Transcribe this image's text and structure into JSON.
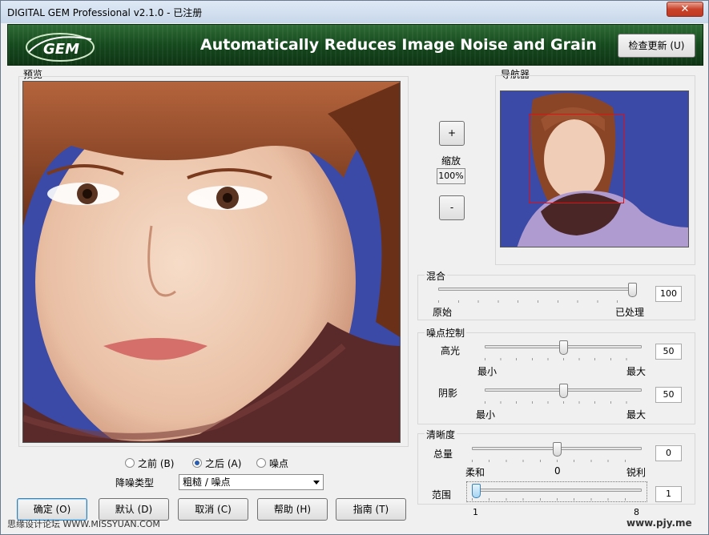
{
  "window": {
    "title": "DIGITAL GEM Professional  v2.1.0 - 已注册",
    "close_label": "✕"
  },
  "banner": {
    "logo_text": "GEM",
    "tagline": "Automatically Reduces Image Noise and Grain",
    "update_label": "检查更新 (U)"
  },
  "preview": {
    "label": "预览"
  },
  "navigator": {
    "label": "导航器"
  },
  "zoom": {
    "plus": "+",
    "label": "缩放",
    "value": "100%",
    "minus": "-"
  },
  "blend": {
    "label": "混合",
    "value": "100",
    "min_label": "原始",
    "max_label": "已处理",
    "level": 1.0
  },
  "noise": {
    "label": "噪点控制",
    "highlight": {
      "label": "高光",
      "value": "50",
      "min": "最小",
      "max": "最大",
      "level": 0.5
    },
    "shadow": {
      "label": "阴影",
      "value": "50",
      "min": "最小",
      "max": "最大",
      "level": 0.5
    }
  },
  "sharpness": {
    "label": "清晰度",
    "amount": {
      "label": "总量",
      "value": "0",
      "min": "柔和",
      "mid": "0",
      "max": "锐利",
      "level": 0.5
    },
    "radius": {
      "label": "范围",
      "value": "1",
      "min": "1",
      "max": "8",
      "level": 0.0
    }
  },
  "view": {
    "before": "之前 (B)",
    "after": "之后 (A)",
    "noise": "噪点",
    "selected": "after"
  },
  "denoise_type": {
    "label": "降噪类型",
    "value": "粗糙 / 噪点"
  },
  "buttons": {
    "ok": "确定 (O)",
    "default": "默认 (D)",
    "cancel": "取消 (C)",
    "help": "帮助 (H)",
    "guide": "指南 (T)"
  },
  "watermarks": {
    "left": "思缘设计论坛 WWW.MISSYUAN.COM",
    "right": "www.pjy.me"
  },
  "colors": {
    "banner": "#164a1e",
    "nav_box": "#e01010",
    "preview_bg": "#3b4aa6"
  }
}
